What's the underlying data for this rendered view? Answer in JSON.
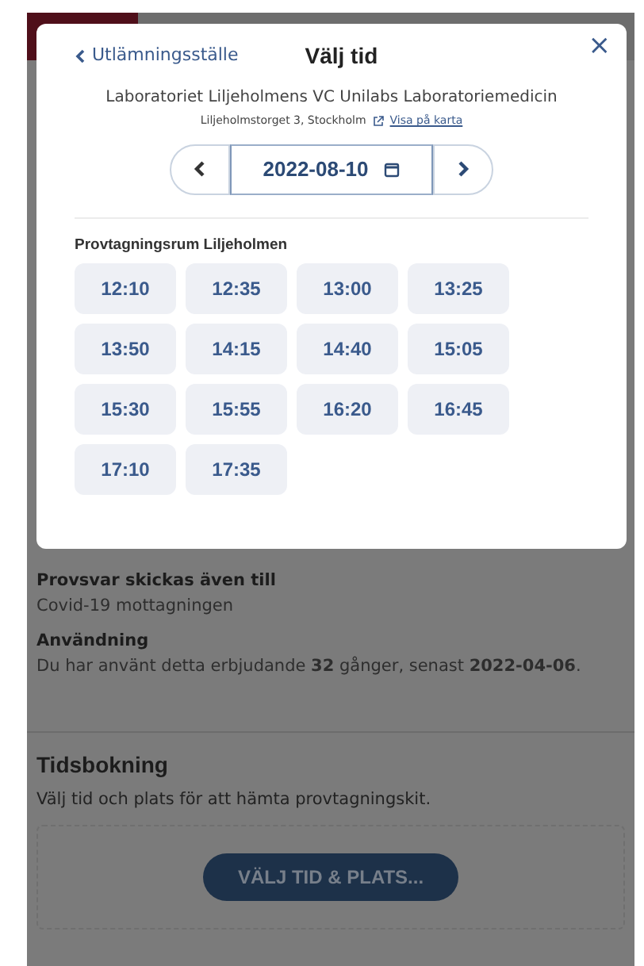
{
  "modal": {
    "back_link": "Utlämningsställe",
    "title": "Välj tid",
    "close": "×",
    "lab_name": "Laboratoriet Liljeholmens VC Unilabs Laboratoriemedicin",
    "address": "Liljeholmstorget 3, Stockholm",
    "map_link": "Visa på karta",
    "date": "2022-08-10",
    "room": "Provtagningsrum Liljeholmen",
    "times": [
      "12:10",
      "12:35",
      "13:00",
      "13:25",
      "13:50",
      "14:15",
      "14:40",
      "15:05",
      "15:30",
      "15:55",
      "16:20",
      "16:45",
      "17:10",
      "17:35"
    ]
  },
  "background": {
    "sections": [
      {
        "heading": "Provsvar skickas även till",
        "text": "Covid-19 mottagningen"
      },
      {
        "heading": "Användning",
        "text": "Du har använt detta erbjudande **32** gånger, senast **2022-04-06**."
      }
    ],
    "booking": {
      "title": "Tidsbokning",
      "text": "Välj tid och plats för att hämta provtagningskit.",
      "button": "VÄLJ TID & PLATS..."
    }
  }
}
